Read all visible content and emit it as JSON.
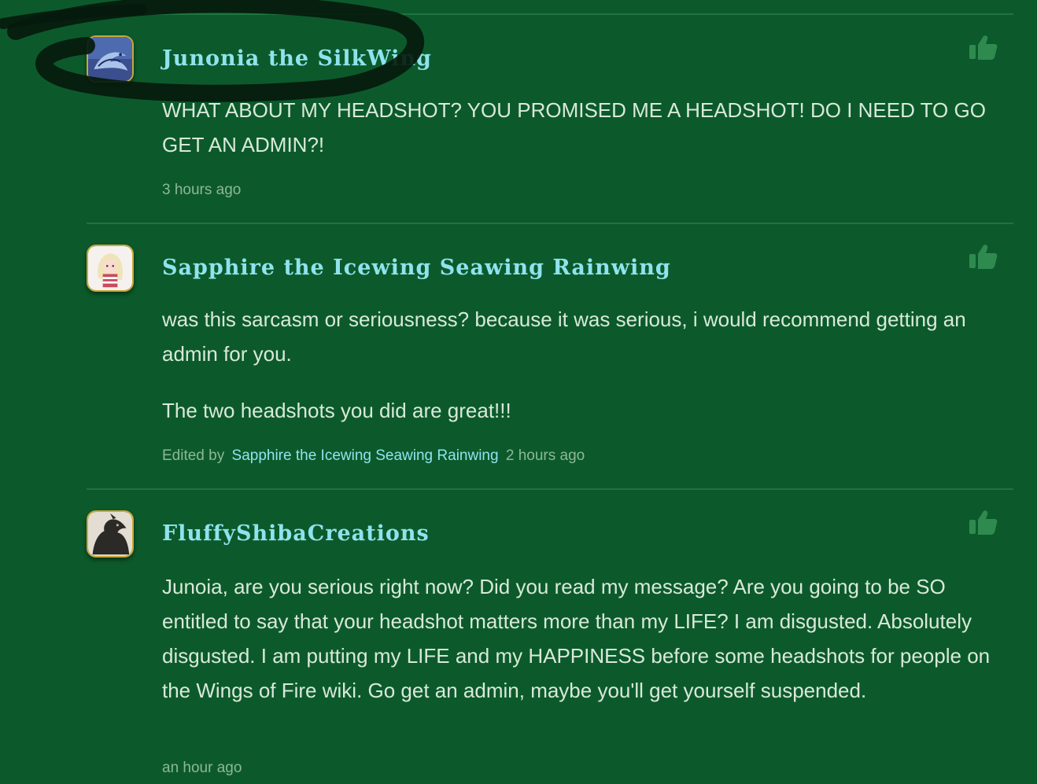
{
  "comments": [
    {
      "username": "Junonia the SilkWing",
      "text": [
        "WHAT ABOUT MY HEADSHOT? YOU PROMISED ME A HEADSHOT! DO I NEED TO GO GET AN ADMIN?!"
      ],
      "timestamp": "3 hours ago",
      "avatar_icon": "blue-dragon-avatar"
    },
    {
      "username": "Sapphire the Icewing Seawing Rainwing",
      "text": [
        "was this sarcasm or seriousness? because it was serious, i would recommend getting an admin for you.",
        "The two headshots you did are great!!!"
      ],
      "edited_prefix": "Edited by",
      "edited_by": "Sapphire the Icewing Seawing Rainwing",
      "timestamp": "2 hours ago",
      "avatar_icon": "anime-girl-avatar"
    },
    {
      "username": "FluffyShibaCreations",
      "text": [
        "Junoia, are you serious right now? Did you read my message? Are you going to be SO entitled to say that your headshot matters more than my LIFE? I am disgusted. Absolutely disgusted. I am putting my LIFE and my HAPPINESS before some headshots for people on the Wings of Fire wiki. Go get an admin, maybe you'll get yourself suspended."
      ],
      "timestamp": "an hour ago",
      "avatar_icon": "black-dragon-avatar"
    }
  ],
  "colors": {
    "background": "#0c5a2b",
    "username": "#8fe3ee",
    "text": "#d8e9da",
    "meta": "#8db79a",
    "avatar_border": "#c9a73a"
  }
}
